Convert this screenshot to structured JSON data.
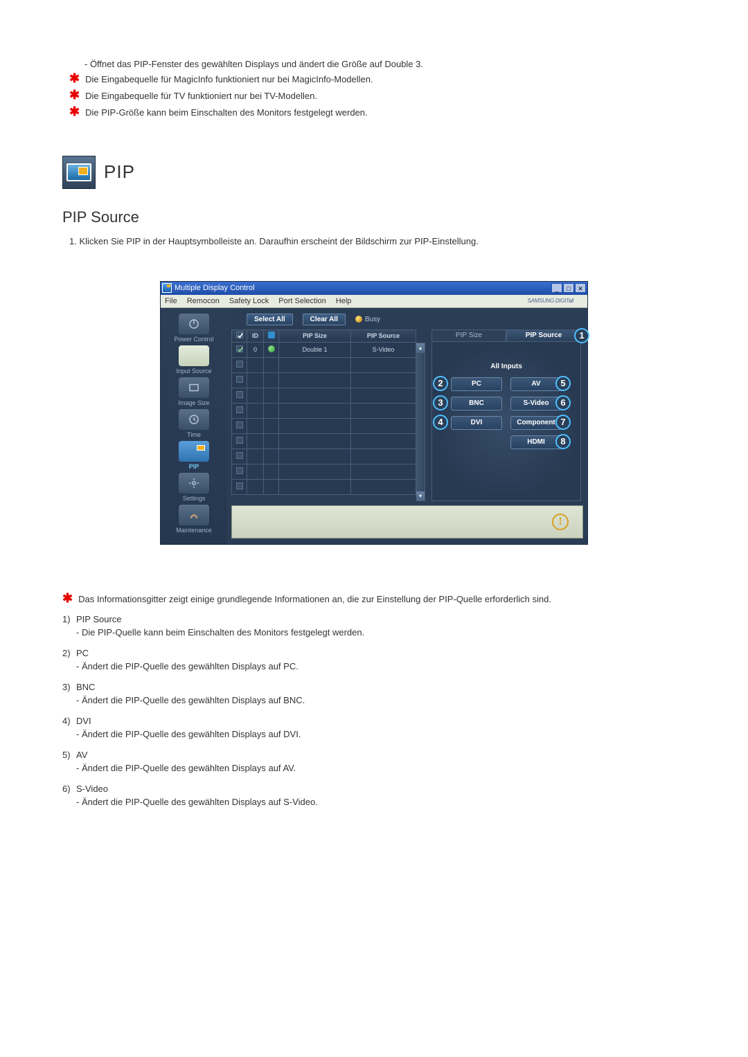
{
  "top_notes": {
    "sub": "- Öffnet das PIP-Fenster des gewählten Displays und ändert die Größe auf Double 3.",
    "stars": [
      "Die Eingabequelle für MagicInfo funktioniert nur bei MagicInfo-Modellen.",
      "Die Eingabequelle für TV funktioniert nur bei TV-Modellen.",
      "Die PIP-Größe kann beim Einschalten des Monitors festgelegt werden."
    ]
  },
  "section": {
    "title": "PIP"
  },
  "subheading": "PIP Source",
  "intro": "1. Klicken Sie PIP in der Hauptsymbolleiste an. Daraufhin erscheint der Bildschirm zur PIP-Einstellung.",
  "app": {
    "title": "Multiple Display Control",
    "menu": [
      "File",
      "Remocon",
      "Safety Lock",
      "Port Selection",
      "Help"
    ],
    "brand": "SAMSUNG DIGITall",
    "sidebar": [
      {
        "label": "Power Control"
      },
      {
        "label": "Input Source"
      },
      {
        "label": "Image Size"
      },
      {
        "label": "Time"
      },
      {
        "label": "PIP",
        "active": true
      },
      {
        "label": "Settings"
      },
      {
        "label": "Maintenance"
      }
    ],
    "toolbar": {
      "select_all": "Select All",
      "clear_all": "Clear All",
      "busy": "Busy"
    },
    "grid": {
      "headers": [
        "",
        "ID",
        "",
        "PIP Size",
        "PIP Source"
      ],
      "row0": {
        "id": "0",
        "size": "Double 1",
        "src": "S-Video"
      }
    },
    "tabs": {
      "left": "PIP Size",
      "right": "PIP Source",
      "all": "All Inputs"
    },
    "sources": {
      "pc": "PC",
      "av": "AV",
      "bnc": "BNC",
      "svideo": "S-Video",
      "dvi": "DVI",
      "component": "Component",
      "hdmi": "HDMI"
    }
  },
  "bottom": {
    "star": "Das Informationsgitter zeigt einige grundlegende Informationen an, die zur Einstellung der PIP-Quelle erforderlich sind.",
    "items": [
      {
        "n": "1)",
        "title": "PIP Source",
        "desc": "- Die PIP-Quelle kann beim Einschalten des Monitors festgelegt werden."
      },
      {
        "n": "2)",
        "title": "PC",
        "desc": "- Ändert die PIP-Quelle des gewählten Displays auf PC."
      },
      {
        "n": "3)",
        "title": "BNC",
        "desc": "- Ändert die PIP-Quelle des gewählten Displays auf BNC."
      },
      {
        "n": "4)",
        "title": "DVI",
        "desc": "- Ändert die PIP-Quelle des gewählten Displays auf DVI."
      },
      {
        "n": "5)",
        "title": "AV",
        "desc": "- Ändert die PIP-Quelle des gewählten Displays auf AV."
      },
      {
        "n": "6)",
        "title": "S-Video",
        "desc": "- Ändert die PIP-Quelle des gewählten Displays auf S-Video."
      }
    ]
  }
}
